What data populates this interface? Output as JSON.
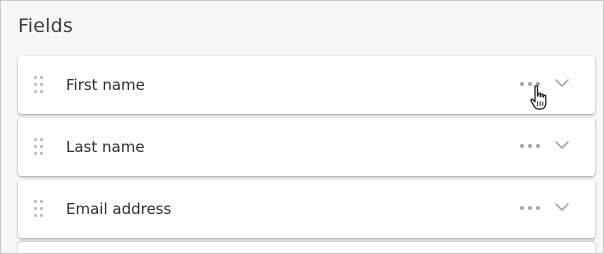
{
  "section": {
    "title": "Fields"
  },
  "fields": [
    {
      "label": "First name"
    },
    {
      "label": "Last name"
    },
    {
      "label": "Email address"
    }
  ],
  "icons": {
    "drag": "drag-handle-icon",
    "more": "more-options-icon",
    "expand": "chevron-down-icon",
    "cursor": "hand-pointer-cursor"
  },
  "colors": {
    "background": "#f7f7f7",
    "card": "#ffffff",
    "text": "#2f2f2f",
    "icon": "#a7a7a7"
  }
}
